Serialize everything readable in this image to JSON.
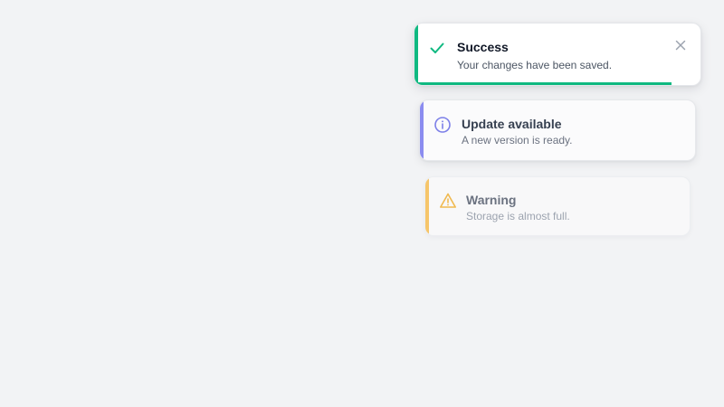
{
  "toasts": [
    {
      "type": "success",
      "title": "Success",
      "message": "Your changes have been saved.",
      "icon": "checkmark-icon",
      "accent_color": "#10b981",
      "dismiss_icon": "close-icon",
      "progress_remaining": 0.9
    },
    {
      "type": "info",
      "title": "Update available",
      "message": "A new version is ready.",
      "icon": "info-icon",
      "accent_color": "#8b8cf0"
    },
    {
      "type": "warning",
      "title": "Warning",
      "message": "Storage is almost full.",
      "icon": "warning-triangle-icon",
      "accent_color": "#f6c56a"
    }
  ],
  "colors": {
    "background": "#f2f3f5",
    "success": "#10b981",
    "info": "#8b8cf0",
    "warning": "#f6c56a"
  }
}
